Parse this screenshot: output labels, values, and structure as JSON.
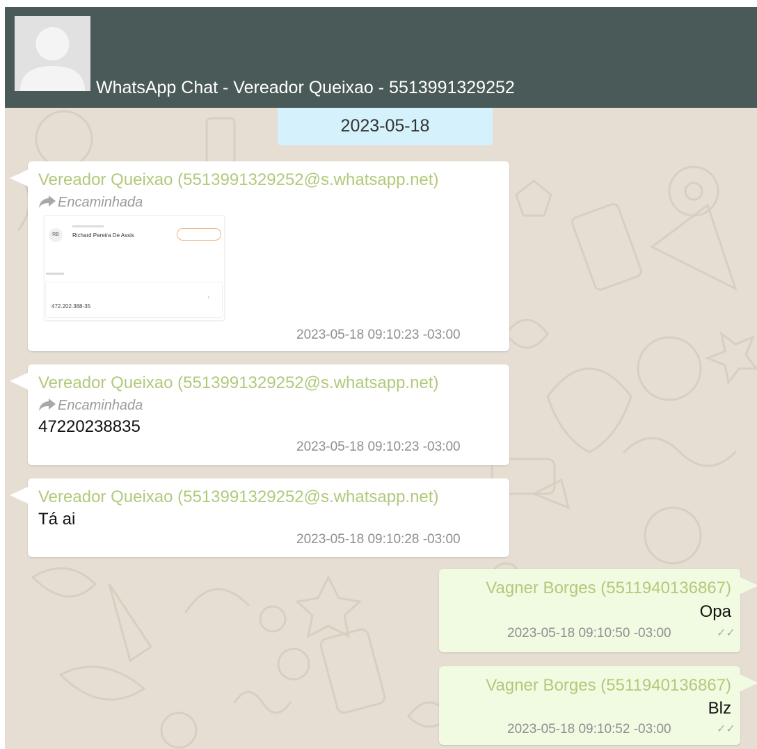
{
  "header": {
    "title": "WhatsApp Chat - Vereador Queixao - 5513991329252"
  },
  "date_divider": "2023-05-18",
  "forwarded_label": "Encaminhada",
  "messages": [
    {
      "direction": "incoming",
      "sender": "Vereador Queixao (5513991329252@s.whatsapp.net)",
      "forwarded": true,
      "attachment": {
        "type": "image",
        "initials": "RB",
        "name": "Richard Pereira De Assis",
        "value": "472.202.388-35"
      },
      "timestamp": "2023-05-18 09:10:23 -03:00"
    },
    {
      "direction": "incoming",
      "sender": "Vereador Queixao (5513991329252@s.whatsapp.net)",
      "forwarded": true,
      "text": "47220238835",
      "timestamp": "2023-05-18 09:10:23 -03:00"
    },
    {
      "direction": "incoming",
      "sender": "Vereador Queixao (5513991329252@s.whatsapp.net)",
      "forwarded": false,
      "text": "Tá ai",
      "timestamp": "2023-05-18 09:10:28 -03:00"
    },
    {
      "direction": "outgoing",
      "sender": "Vagner Borges (5511940136867)",
      "text": "Opa",
      "timestamp": "2023-05-18 09:10:50 -03:00",
      "status": "✓✓"
    },
    {
      "direction": "outgoing",
      "sender": "Vagner Borges (5511940136867)",
      "text": "Blz",
      "timestamp": "2023-05-18 09:10:52 -03:00",
      "status": "✓✓"
    }
  ],
  "colors": {
    "header_bg": "#4a5a58",
    "chat_bg": "#e6ded2",
    "date_chip_bg": "#d5f1fb",
    "incoming_bubble": "#ffffff",
    "outgoing_bubble": "#f1fbe1",
    "sender_name": "#b2c97c",
    "timestamp": "#8e8e8e"
  },
  "icons": [
    "avatar-placeholder-icon",
    "forward-arrow-icon",
    "double-check-icon"
  ]
}
